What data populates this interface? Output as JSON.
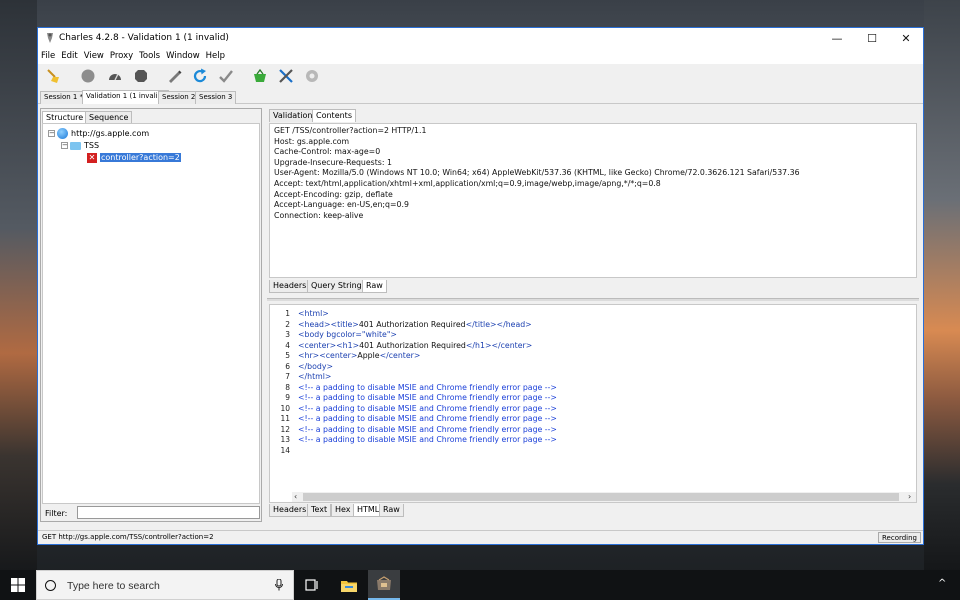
{
  "window": {
    "title": "Charles 4.2.8 - Validation 1 (1 invalid)",
    "controls": {
      "minimize": "—",
      "maximize": "☐",
      "close": "✕"
    }
  },
  "menu": [
    "File",
    "Edit",
    "View",
    "Proxy",
    "Tools",
    "Window",
    "Help"
  ],
  "toolbar": {
    "icons": [
      "broom-icon",
      "record-icon",
      "throttle-icon",
      "breakpoint-icon",
      "pen-icon",
      "refresh-icon",
      "check-icon",
      "basket-icon",
      "tools-icon",
      "settings-icon"
    ]
  },
  "sessions": [
    "Session 1 *",
    "Validation 1 (1 invalid)",
    "Session 2",
    "Session 3"
  ],
  "left_panel": {
    "tabs": [
      "Structure",
      "Sequence"
    ],
    "tree": {
      "host": "http://gs.apple.com",
      "folder": "TSS",
      "file": "controller?action=2"
    },
    "filter_label": "Filter:",
    "filter_value": ""
  },
  "request": {
    "tabs": [
      "Validation",
      "Contents"
    ],
    "lines": [
      "GET /TSS/controller?action=2 HTTP/1.1",
      "Host: gs.apple.com",
      "Cache-Control: max-age=0",
      "Upgrade-Insecure-Requests: 1",
      "User-Agent: Mozilla/5.0 (Windows NT 10.0; Win64; x64) AppleWebKit/537.36 (KHTML, like Gecko) Chrome/72.0.3626.121 Safari/537.36",
      "Accept: text/html,application/xhtml+xml,application/xml;q=0.9,image/webp,image/apng,*/*;q=0.8",
      "Accept-Encoding: gzip, deflate",
      "Accept-Language: en-US,en;q=0.9",
      "Connection: keep-alive"
    ],
    "bottom_tabs": [
      "Headers",
      "Query String",
      "Raw"
    ]
  },
  "response": {
    "line_numbers": [
      "1",
      "2",
      "3",
      "4",
      "5",
      "6",
      "7",
      "8",
      "9",
      "10",
      "11",
      "12",
      "13",
      "14"
    ],
    "code": [
      {
        "t": "tag",
        "s": "<html>"
      },
      {
        "t": "mix",
        "parts": [
          [
            "tag",
            "<head><title>"
          ],
          [
            "txt",
            "401 Authorization Required"
          ],
          [
            "tag",
            "</title></head>"
          ]
        ]
      },
      {
        "t": "tag",
        "s": "<body bgcolor=\"white\">"
      },
      {
        "t": "mix",
        "parts": [
          [
            "tag",
            "<center><h1>"
          ],
          [
            "txt",
            "401 Authorization Required"
          ],
          [
            "tag",
            "</h1></center>"
          ]
        ]
      },
      {
        "t": "mix",
        "parts": [
          [
            "tag",
            "<hr><center>"
          ],
          [
            "txt",
            "Apple"
          ],
          [
            "tag",
            "</center>"
          ]
        ]
      },
      {
        "t": "tag",
        "s": "</body>"
      },
      {
        "t": "tag",
        "s": "</html>"
      },
      {
        "t": "cmt",
        "s": "<!-- a padding to disable MSIE and Chrome friendly error page -->"
      },
      {
        "t": "cmt",
        "s": "<!-- a padding to disable MSIE and Chrome friendly error page -->"
      },
      {
        "t": "cmt",
        "s": "<!-- a padding to disable MSIE and Chrome friendly error page -->"
      },
      {
        "t": "cmt",
        "s": "<!-- a padding to disable MSIE and Chrome friendly error page -->"
      },
      {
        "t": "cmt",
        "s": "<!-- a padding to disable MSIE and Chrome friendly error page -->"
      },
      {
        "t": "cmt",
        "s": "<!-- a padding to disable MSIE and Chrome friendly error page -->"
      },
      {
        "t": "txt",
        "s": ""
      }
    ],
    "bottom_tabs": [
      "Headers",
      "Text",
      "Hex",
      "HTML",
      "Raw"
    ]
  },
  "status": {
    "text": "GET http://gs.apple.com/TSS/controller?action=2",
    "recording": "Recording"
  },
  "taskbar": {
    "search_placeholder": "Type here to search",
    "tray_arrow": "^"
  }
}
